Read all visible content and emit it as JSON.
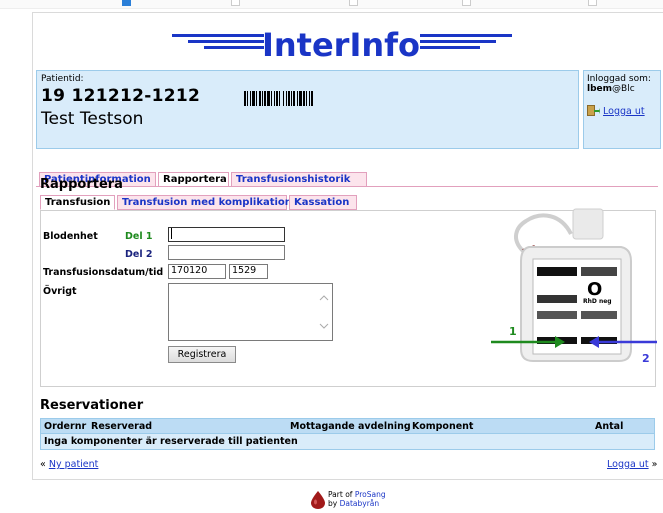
{
  "app": {
    "logo_text": "InterInfo"
  },
  "patient": {
    "id_label": "Patientid:",
    "id": "19 121212-1212",
    "name": "Test Testson"
  },
  "login": {
    "label": "Inloggad som:",
    "user_bold": "lbem",
    "user_rest": "@Blc",
    "logout": "Logga ut"
  },
  "main_tabs": [
    {
      "label": "Patientinformation",
      "active": false
    },
    {
      "label": "Rapportera",
      "active": true
    },
    {
      "label": "Transfusionshistorik",
      "active": false
    }
  ],
  "section_title": "Rapportera",
  "sub_tabs": [
    {
      "label": "Transfusion",
      "active": true
    },
    {
      "label": "Transfusion med komplikation",
      "active": false
    },
    {
      "label": "Kassation",
      "active": false
    }
  ],
  "form": {
    "blodenhet_label": "Blodenhet",
    "del1_label": "Del 1",
    "del2_label": "Del 2",
    "del1_value": "",
    "del2_value": "",
    "datum_label": "Transfusionsdatum/tid",
    "date_value": "170120",
    "time_value": "1529",
    "ovrigt_label": "Övrigt",
    "ovrigt_value": "",
    "submit": "Registrera"
  },
  "blood_bag": {
    "group": "O",
    "rh": "RhD neg",
    "arrow1_label": "1",
    "arrow2_label": "2",
    "arrow1_color": "#1e8a1e",
    "arrow2_color": "#3a3ad8"
  },
  "reservations": {
    "title": "Reservationer",
    "columns": [
      "Ordernr",
      "Reserverad",
      "Mottagande avdelning",
      "Komponent",
      "Antal"
    ],
    "empty_text": "Inga komponenter är reserverade till patienten"
  },
  "footer": {
    "new_patient_prefix": "«",
    "new_patient": "Ny patient",
    "logout": "Logga ut",
    "logout_suffix": "»",
    "credit_line1_prefix": "Part of",
    "credit_line1_link": "ProSang",
    "credit_line2_prefix": "by",
    "credit_line2_link": "Databyrån"
  },
  "colors": {
    "accent_blue": "#1a35c6",
    "panel_blue": "#d9ecfa",
    "tab_pink": "#fce4ec",
    "del1_green": "#1e8a1e",
    "del2_navy": "#1a237e"
  }
}
